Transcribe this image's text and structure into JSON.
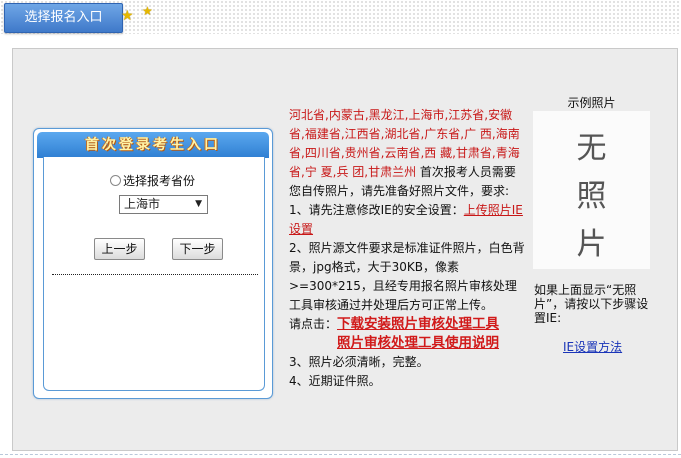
{
  "top": {
    "tab_label": "选择报名入口"
  },
  "login": {
    "title": "首次登录考生入口",
    "radio_label": "选择报考省份",
    "province_selected": "上海市",
    "prev_button": "上一步",
    "next_button": "下一步"
  },
  "instructions": {
    "provinces_text": "河北省,内蒙古,黑龙江,上海市,江苏省,安徽省,福建省,江西省,湖北省,广东省,广 西,海南省,四川省,贵州省,云南省,西 藏,甘肃省,青海省,宁 夏,兵 团,甘肃兰州",
    "intro_text": " 首次报考人员需要您自传照片，请先准备好照片文件，要求:",
    "item1_prefix": "1、请先注意修改IE的安全设置：",
    "item1_link": "上传照片IE设置",
    "item2": "2、照片源文件要求是标准证件照片，白色背景，jpg格式，大于30KB，像素>=300*215，且经专用报名照片审核处理工具审核通过并处理后方可正常上传。",
    "click_label": "请点击：",
    "download_link": "下载安装照片审核处理工具",
    "manual_link": "照片审核处理工具使用说明",
    "item3": "3、照片必须清晰，完整。",
    "item4": "4、近期证件照。"
  },
  "sample": {
    "label": "示例照片",
    "photo_chars": [
      "无",
      "照",
      "片"
    ],
    "note": "如果上面显示“无照片”，请按以下步骤设置IE:",
    "ie_link": "IE设置方法"
  }
}
